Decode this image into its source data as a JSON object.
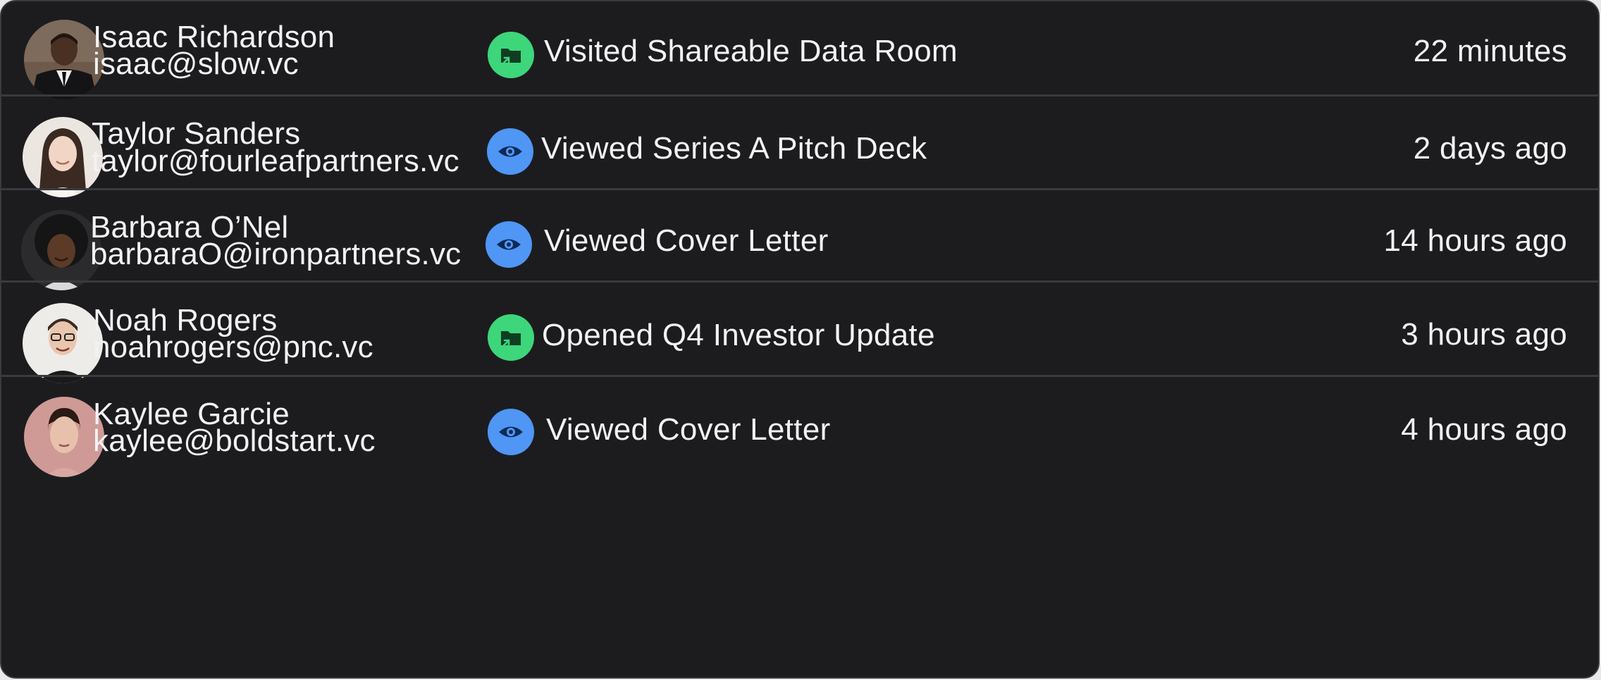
{
  "activity_rows": [
    {
      "name": "Isaac Richardson",
      "email": "isaac@slow.vc",
      "avatar": "man-in-suit-avatar",
      "event_icon": "folder-share-icon",
      "event_text": "Visited Shareable Data Room",
      "time": "22 minutes"
    },
    {
      "name": "Taylor Sanders",
      "email": "taylor@fourleafpartners.vc",
      "avatar": "woman-smiling-avatar",
      "event_icon": "eye-icon",
      "event_text": "Viewed Series A Pitch Deck",
      "time": "2 days ago"
    },
    {
      "name": "Barbara O’Nel",
      "email": "barbaraO@ironpartners.vc",
      "avatar": "woman-curly-hair-avatar",
      "event_icon": "eye-icon",
      "event_text": "Viewed Cover Letter",
      "time": "14 hours ago"
    },
    {
      "name": "Noah Rogers",
      "email": "noahrogers@pnc.vc",
      "avatar": "man-with-glasses-avatar",
      "event_icon": "folder-share-icon",
      "event_text": "Opened Q4 Investor Update",
      "time": "3 hours ago"
    },
    {
      "name": "Kaylee Garcie",
      "email": "kaylee@boldstart.vc",
      "avatar": "woman-portrait-avatar",
      "event_icon": "eye-icon",
      "event_text": "Viewed Cover Letter",
      "time": "4 hours ago"
    }
  ],
  "colors": {
    "background": "#1c1c1f",
    "divider": "#3a3a3e",
    "text": "#f2f2f4",
    "folder_accent": "#3dd67a",
    "eye_accent": "#4f96f5"
  }
}
